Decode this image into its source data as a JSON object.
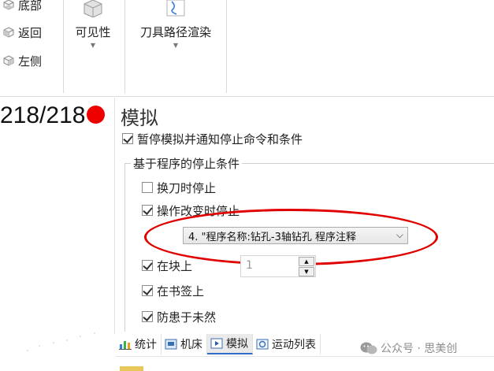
{
  "ribbon": {
    "view_items": [
      {
        "label": "底部",
        "icon": "cube-bottom-icon"
      },
      {
        "label": "返回",
        "icon": "cube-back-icon"
      },
      {
        "label": "左侧",
        "icon": "cube-left-icon"
      }
    ],
    "visibility_label": "可见性",
    "toolpath_render_label": "刀具路径渲染"
  },
  "counter": {
    "text": "218/218",
    "status_color": "#ee0000"
  },
  "panel": {
    "title": "模拟",
    "pause_notify_label": "暂停模拟并通知停止命令和条件",
    "group_title": "基于程序的停止条件",
    "options": [
      {
        "label": "换刀时停止",
        "checked": false
      },
      {
        "label": "操作改变时停止",
        "checked": true
      },
      {
        "label": "在块上",
        "checked": true
      },
      {
        "label": "在书签上",
        "checked": true
      },
      {
        "label": "防患于未然",
        "checked": true
      }
    ],
    "operation_select_value": "4. \"程序名称:钻孔-3轴钻孔 程序注释",
    "block_value": "1"
  },
  "tabs": [
    {
      "label": "统计",
      "icon": "statistics-icon"
    },
    {
      "label": "机床",
      "icon": "machine-icon"
    },
    {
      "label": "模拟",
      "icon": "simulate-play-icon",
      "active": true
    },
    {
      "label": "运动列表",
      "icon": "motion-list-icon"
    }
  ],
  "watermark": {
    "text": "公众号 · 思美创",
    "icon": "wechat-icon"
  },
  "colors": {
    "highlight_ellipse": "#e00000",
    "accent": "#2c6ec9"
  }
}
